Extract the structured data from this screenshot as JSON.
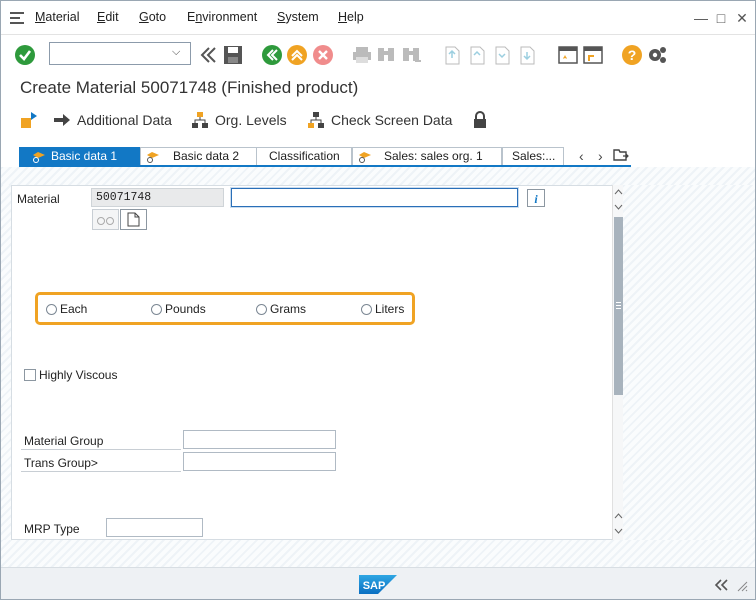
{
  "menubar": {
    "items": [
      {
        "label": "Material",
        "u": "M"
      },
      {
        "label": "Edit",
        "u": "E"
      },
      {
        "label": "Goto",
        "u": "G"
      },
      {
        "label": "Environment",
        "u": "n"
      },
      {
        "label": "System",
        "u": "S"
      },
      {
        "label": "Help",
        "u": "H"
      }
    ]
  },
  "toolbar": {
    "command_field_value": "",
    "icons": [
      "enter-icon",
      "back-icon",
      "save-icon",
      "back-green-icon",
      "exit-icon",
      "cancel-icon",
      "print-icon",
      "find-icon",
      "find-next-icon",
      "first-page-icon",
      "prev-page-icon",
      "next-page-icon",
      "last-page-icon",
      "new-session-icon",
      "shortcut-icon",
      "help-icon",
      "settings-icon"
    ]
  },
  "title": "Create Material 50071748 (Finished product)",
  "app_toolbar": {
    "additional_data": "Additional Data",
    "org_levels": "Org. Levels",
    "check_screen_data": "Check Screen Data"
  },
  "tabs": [
    {
      "label": "Basic data 1",
      "active": true
    },
    {
      "label": "Basic data 2",
      "active": false
    },
    {
      "label": "Classification",
      "active": false
    },
    {
      "label": "Sales: sales org. 1",
      "active": false
    },
    {
      "label": "Sales:...",
      "active": false
    }
  ],
  "form": {
    "material_label": "Material",
    "material_value": "50071748",
    "description_value": "",
    "radios": [
      "Each",
      "Pounds",
      "Grams",
      "Liters"
    ],
    "highly_viscous": "Highly Viscous",
    "material_group_label": "Material Group",
    "material_group_value": "",
    "trans_group_label": "Trans Group>",
    "trans_group_value": "",
    "mrp_type_label": "MRP Type",
    "mrp_type_value": ""
  },
  "status": {
    "logo": "SAP"
  },
  "colors": {
    "accent_blue": "#1278c5",
    "highlight_orange": "#f0a323",
    "enter_green": "#2e9a3c"
  }
}
